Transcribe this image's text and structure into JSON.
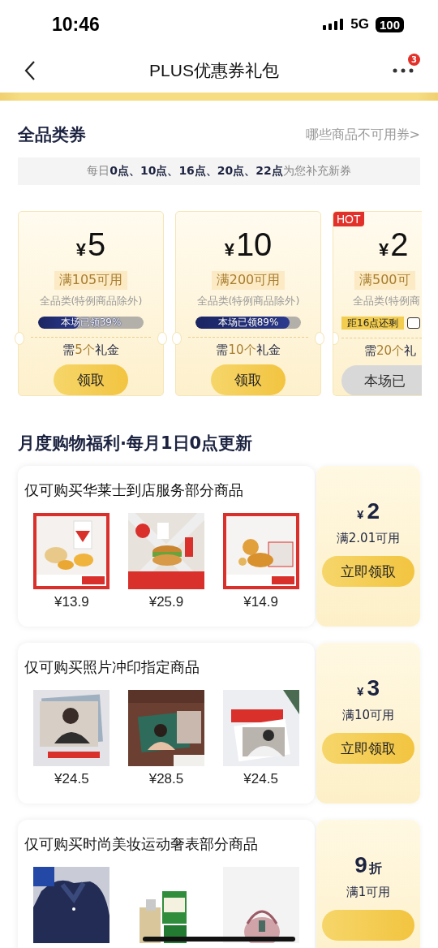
{
  "status_bar": {
    "time": "10:46",
    "network": "5G",
    "battery": "100"
  },
  "header": {
    "title": "PLUS优惠券礼包",
    "badge": "3"
  },
  "all_category": {
    "title": "全品类券",
    "link": "哪些商品不可用券>",
    "notice": "每日**0点、10点、16点、20点、22点**为您补充新券",
    "coupons": [
      {
        "currency": "¥",
        "amount": "5",
        "min": "满105可用",
        "scope": "全品类(特例商品除外)",
        "hot": false,
        "progress": {
          "kind": "claimed",
          "label": "本场已领39%",
          "level": 0.39
        },
        "need_before": "需",
        "need_count": "5个",
        "need_after": "礼金",
        "button": {
          "label": "领取",
          "enabled": true
        }
      },
      {
        "currency": "¥",
        "amount": "10",
        "min": "满200可用",
        "scope": "全品类(特例商品除外)",
        "hot": false,
        "progress": {
          "kind": "claimed",
          "label": "本场已领89%",
          "level": 0.89
        },
        "need_before": "需",
        "need_count": "10个",
        "need_after": "礼金",
        "button": {
          "label": "领取",
          "enabled": true
        }
      },
      {
        "currency": "¥",
        "amount": "2",
        "min": "满500可",
        "scope": "全品类(特例商",
        "hot": true,
        "hot_label": "HOT",
        "progress": {
          "kind": "countdown",
          "label": "距16点还剩"
        },
        "need_before": "需",
        "need_count": "20个",
        "need_after": "礼",
        "button": {
          "label": "本场已",
          "enabled": false
        }
      }
    ]
  },
  "monthly": {
    "title": "月度购物福利·每月1日0点更新",
    "offers": [
      {
        "title": "仅可购买华莱士到店服务部分商品",
        "products": [
          {
            "kind": "picture",
            "price": "¥13.9"
          },
          {
            "kind": "picture",
            "price": "¥25.9"
          },
          {
            "kind": "picture",
            "price": "¥14.9"
          }
        ],
        "coupon": {
          "kind": "cash",
          "currency": "¥",
          "amount": "2",
          "min": "满2.01可用",
          "button": "立即领取"
        }
      },
      {
        "title": "仅可购买照片冲印指定商品",
        "products": [
          {
            "kind": "picture",
            "price": "¥24.5"
          },
          {
            "kind": "picture",
            "price": "¥28.5"
          },
          {
            "kind": "picture",
            "price": "¥24.5"
          }
        ],
        "coupon": {
          "kind": "cash",
          "currency": "¥",
          "amount": "3",
          "min": "满10可用",
          "button": "立即领取"
        }
      },
      {
        "title": "仅可购买时尚美妆运动奢表部分商品",
        "coupon": {
          "kind": "discount",
          "amount": "9",
          "unit": "折",
          "min": "满1可用"
        }
      }
    ]
  }
}
